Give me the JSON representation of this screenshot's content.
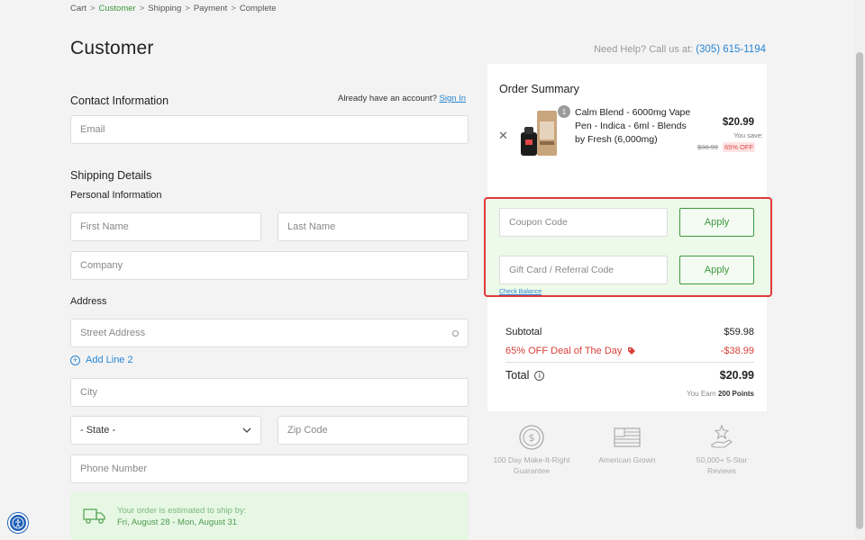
{
  "breadcrumb": [
    {
      "label": "Cart",
      "active": false
    },
    {
      "label": "Customer",
      "active": true
    },
    {
      "label": "Shipping",
      "active": false
    },
    {
      "label": "Payment",
      "active": false
    },
    {
      "label": "Complete",
      "active": false
    }
  ],
  "breadcrumb_sep": ">",
  "page_title": "Customer",
  "help": {
    "text": "Need Help? Call us at:",
    "phone": "(305) 615-1194"
  },
  "contact": {
    "title": "Contact Information",
    "account_prompt": "Already have an account?",
    "signin_label": "Sign In",
    "email_placeholder": "Email"
  },
  "shipping": {
    "title": "Shipping Details",
    "personal_title": "Personal Information",
    "first_name_placeholder": "First Name",
    "last_name_placeholder": "Last Name",
    "company_placeholder": "Company",
    "address_title": "Address",
    "street_placeholder": "Street Address",
    "add_line_label": "Add Line 2",
    "city_placeholder": "City",
    "state_value": "- State -",
    "zip_placeholder": "Zip Code",
    "phone_placeholder": "Phone Number",
    "estimate_text": "Your order is estimated to ship by:",
    "estimate_dates": "Fri, August 28 - Mon, August 31"
  },
  "summary": {
    "title": "Order Summary",
    "product": {
      "qty": "1",
      "name": "Calm Blend - 6000mg Vape Pen - Indica - 6ml - Blends by Fresh (6,000mg)",
      "price": "$20.99",
      "you_save": "You save:",
      "was_price": "$38.99",
      "off_badge": "65% OFF"
    },
    "coupon_placeholder": "Coupon Code",
    "giftcard_placeholder": "Gift Card / Referral Code",
    "apply_label": "Apply",
    "check_balance": "Check Balance",
    "subtotal_label": "Subtotal",
    "subtotal_value": "$59.98",
    "deal_label": "65% OFF Deal of The Day",
    "deal_value": "-$38.99",
    "total_label": "Total",
    "total_value": "$20.99",
    "earn_prefix": "You Earn",
    "earn_points": "200 Points"
  },
  "badges": [
    {
      "icon": "dollar-guarantee-icon",
      "label": "100 Day Make-It-Right Guarantee"
    },
    {
      "icon": "american-flag-icon",
      "label": "American Grown"
    },
    {
      "icon": "star-hand-icon",
      "label": "50,000+ 5-Star Reviews"
    }
  ],
  "colors": {
    "accent_green": "#3f9a3f",
    "link_blue": "#2a86d3",
    "deal_red": "#d8403a",
    "highlight_border": "#e03a3a",
    "coupon_bg": "#edf9e9",
    "ship_box_bg": "#e6f7e4"
  }
}
